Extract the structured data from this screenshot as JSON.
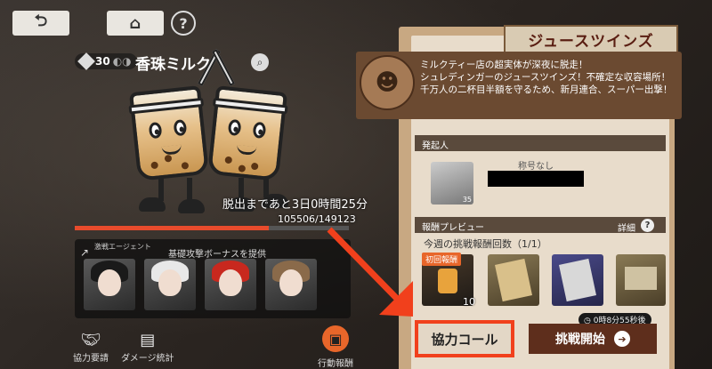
{
  "header": {
    "back_icon": "return-icon",
    "home_icon": "home-icon",
    "help_label": "?"
  },
  "boss": {
    "level": "30",
    "name": "香珠ミルク",
    "timer": "脱出まであと3日0時間25分",
    "hp_text": "105506/149123",
    "hp_current": 105506,
    "hp_max": 149123
  },
  "agents": {
    "tag": "激戦エージェント",
    "bonus": "基礎攻撃ボーナスを提供",
    "cards": [
      "agent-1",
      "agent-2",
      "agent-3",
      "agent-4"
    ]
  },
  "bottom_bar": {
    "coop_request": "協力要請",
    "damage_stats": "ダメージ統計",
    "action_reward": "行動報酬"
  },
  "panel": {
    "title": "ジュースツインズ",
    "description": [
      "ミルクティー店の超実体が深夜に脱走！",
      "シュレディンガーのジュースツインズ！不確定な収容場所！",
      "千万人の二杯目半額を守るため、新月連合、スーパー出撃！"
    ],
    "initiator_label": "発起人",
    "initiator_level": "35",
    "title_none": "称号なし",
    "reward_preview_label": "報酬プレビュー",
    "detail_label": "詳細",
    "detail_q": "?",
    "weekly_count": "今週の挑戦報酬回数（1/1）",
    "first_badge": "初回報酬",
    "first_reward_count": "10",
    "cooldown": "0時8分55秒後",
    "coop_call": "協力コール",
    "start_challenge": "挑戦開始",
    "start_arrow": "➔"
  },
  "colors": {
    "accent": "#e8662a",
    "highlight": "#f1401c",
    "title": "#5a1e12"
  }
}
